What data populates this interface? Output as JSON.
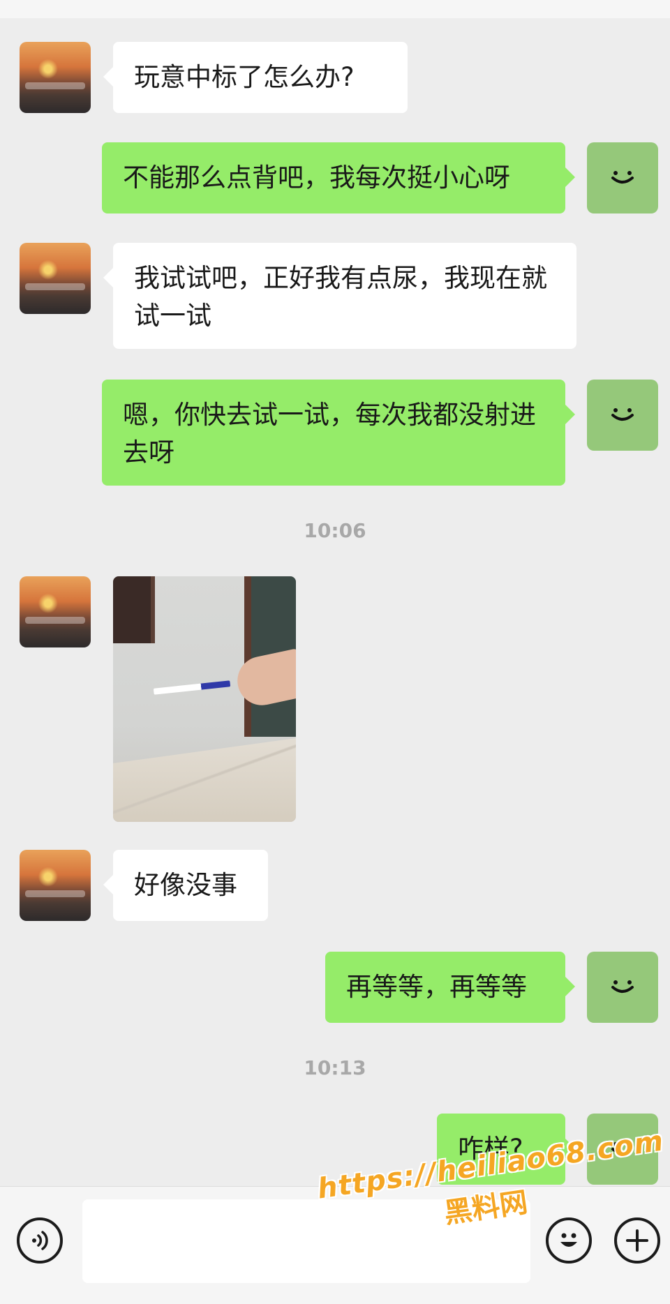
{
  "messages": [
    {
      "side": "left",
      "text": "玩意中标了怎么办?"
    },
    {
      "side": "right",
      "text": "不能那么点背吧，我每次挺小心呀"
    },
    {
      "side": "left",
      "text": "我试试吧，正好我有点尿，我现在就试一试"
    },
    {
      "side": "right",
      "text": "嗯，你快去试一试，每次我都没射进去呀"
    },
    {
      "side": "left",
      "type": "image"
    },
    {
      "side": "left",
      "text": "好像没事"
    },
    {
      "side": "right",
      "text": "再等等，再等等"
    },
    {
      "side": "right",
      "text": "咋样?"
    }
  ],
  "timestamps": [
    "10:06",
    "10:13"
  ],
  "input": {
    "placeholder": ""
  },
  "icons": {
    "voice": "voice-icon",
    "emoji": "emoji-icon",
    "plus": "plus-icon",
    "self_avatar": "smiley-avatar-icon"
  },
  "watermark": {
    "url": "https://heiliao68.com",
    "name": "黑料网"
  },
  "colors": {
    "background": "#ededed",
    "bubble_self": "#95ec69",
    "bubble_other": "#ffffff",
    "self_avatar_bg": "#95c87a",
    "watermark": "#f5a623"
  }
}
